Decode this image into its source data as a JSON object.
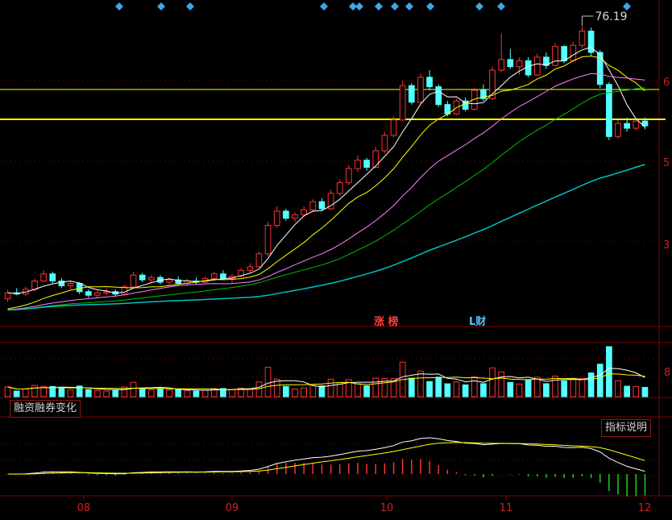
{
  "colors": {
    "bg": "#000000",
    "up": "#ff3232",
    "down": "#54ffff",
    "ma5": "#ffffff",
    "ma10": "#ffff00",
    "ma20": "#ff80ff",
    "ma30": "#00c000",
    "ma60": "#00c0c0",
    "frame": "#800000",
    "diamond": "#3fa7e6",
    "hline": "#ffff00"
  },
  "annotations": {
    "high_label": "76.19",
    "badge_zhangbang": "涨 榜",
    "badge_cai": "L财"
  },
  "tabs": {
    "rzrq": "融资融券变化",
    "indicator_help": "指标说明"
  },
  "right_axis": {
    "price_ticks": [
      "6",
      "5",
      "3"
    ],
    "volume_tick": "8"
  },
  "chart_data": {
    "type": "candlestick",
    "x_month_labels": [
      "08",
      "09",
      "10",
      "11",
      "12"
    ],
    "price_high_marker": 76.19,
    "horizontal_levels": [
      "upper",
      "lower"
    ],
    "panels": [
      "price",
      "volume",
      "macd"
    ],
    "moving_averages": [
      "MA5",
      "MA10",
      "MA20",
      "MA30",
      "MA60"
    ],
    "ohlc": [
      [
        30.0,
        31.5,
        29.5,
        31.0
      ],
      [
        31.0,
        31.8,
        30.6,
        30.8
      ],
      [
        30.8,
        32.0,
        30.5,
        31.6
      ],
      [
        31.6,
        33.4,
        31.2,
        33.0
      ],
      [
        33.0,
        34.8,
        32.8,
        34.2
      ],
      [
        34.2,
        34.6,
        32.6,
        33.0
      ],
      [
        33.0,
        33.5,
        31.8,
        32.2
      ],
      [
        32.2,
        33.0,
        31.6,
        32.6
      ],
      [
        32.6,
        32.8,
        30.8,
        31.2
      ],
      [
        31.2,
        31.6,
        30.2,
        30.6
      ],
      [
        30.6,
        31.4,
        30.2,
        31.0
      ],
      [
        31.0,
        31.8,
        30.6,
        31.2
      ],
      [
        31.2,
        31.6,
        30.4,
        30.8
      ],
      [
        30.8,
        32.4,
        30.6,
        32.0
      ],
      [
        32.0,
        34.6,
        31.8,
        34.0
      ],
      [
        34.0,
        34.4,
        32.8,
        33.2
      ],
      [
        33.2,
        34.0,
        32.6,
        33.6
      ],
      [
        33.6,
        34.0,
        32.4,
        32.8
      ],
      [
        32.8,
        33.6,
        32.2,
        33.2
      ],
      [
        33.2,
        33.8,
        32.4,
        32.6
      ],
      [
        32.6,
        33.4,
        32.2,
        33.0
      ],
      [
        33.0,
        33.6,
        32.4,
        32.8
      ],
      [
        32.8,
        33.8,
        32.6,
        33.4
      ],
      [
        33.4,
        34.6,
        33.0,
        34.2
      ],
      [
        34.2,
        34.8,
        33.2,
        33.4
      ],
      [
        33.4,
        34.2,
        32.6,
        33.8
      ],
      [
        33.8,
        35.2,
        33.6,
        34.8
      ],
      [
        34.8,
        36.0,
        34.4,
        35.4
      ],
      [
        35.4,
        38.0,
        35.2,
        37.6
      ],
      [
        37.6,
        43.0,
        37.2,
        42.4
      ],
      [
        42.4,
        45.6,
        42.0,
        44.8
      ],
      [
        44.8,
        45.2,
        43.2,
        43.6
      ],
      [
        43.6,
        44.6,
        43.0,
        44.2
      ],
      [
        44.2,
        45.6,
        43.8,
        45.0
      ],
      [
        45.0,
        46.8,
        44.6,
        46.4
      ],
      [
        46.4,
        47.0,
        44.8,
        45.2
      ],
      [
        45.2,
        48.4,
        45.0,
        47.8
      ],
      [
        47.8,
        50.2,
        47.4,
        49.6
      ],
      [
        49.6,
        52.6,
        49.2,
        52.0
      ],
      [
        52.0,
        54.2,
        51.4,
        53.4
      ],
      [
        53.4,
        53.8,
        51.6,
        52.2
      ],
      [
        52.2,
        55.6,
        52.0,
        55.0
      ],
      [
        55.0,
        58.2,
        54.6,
        57.6
      ],
      [
        57.6,
        60.8,
        57.2,
        60.2
      ],
      [
        60.2,
        66.8,
        60.0,
        66.0
      ],
      [
        66.0,
        66.4,
        62.8,
        63.2
      ],
      [
        63.2,
        68.0,
        63.0,
        67.4
      ],
      [
        67.4,
        68.6,
        65.2,
        65.8
      ],
      [
        65.8,
        66.2,
        62.4,
        62.8
      ],
      [
        62.8,
        63.4,
        60.8,
        61.2
      ],
      [
        61.2,
        63.8,
        61.0,
        63.4
      ],
      [
        63.4,
        64.0,
        61.6,
        62.0
      ],
      [
        62.0,
        65.6,
        61.8,
        65.2
      ],
      [
        65.2,
        66.2,
        63.4,
        63.8
      ],
      [
        63.8,
        69.2,
        63.6,
        68.6
      ],
      [
        68.6,
        74.8,
        68.2,
        70.4
      ],
      [
        70.4,
        72.2,
        68.8,
        69.2
      ],
      [
        69.2,
        70.8,
        67.8,
        70.2
      ],
      [
        70.2,
        70.8,
        67.4,
        67.8
      ],
      [
        67.8,
        71.4,
        67.6,
        70.8
      ],
      [
        70.8,
        71.6,
        68.8,
        69.4
      ],
      [
        69.4,
        73.2,
        69.2,
        72.6
      ],
      [
        72.6,
        72.8,
        69.8,
        70.2
      ],
      [
        70.2,
        73.4,
        70.0,
        72.8
      ],
      [
        72.8,
        76.19,
        72.4,
        75.2
      ],
      [
        75.2,
        75.8,
        71.0,
        71.6
      ],
      [
        71.6,
        72.0,
        65.6,
        66.2
      ],
      [
        66.2,
        66.6,
        56.8,
        57.4
      ],
      [
        57.4,
        60.2,
        57.0,
        59.6
      ],
      [
        59.6,
        60.6,
        58.2,
        58.8
      ],
      [
        58.8,
        60.4,
        58.4,
        60.0
      ],
      [
        60.0,
        60.6,
        58.6,
        59.2
      ]
    ]
  }
}
